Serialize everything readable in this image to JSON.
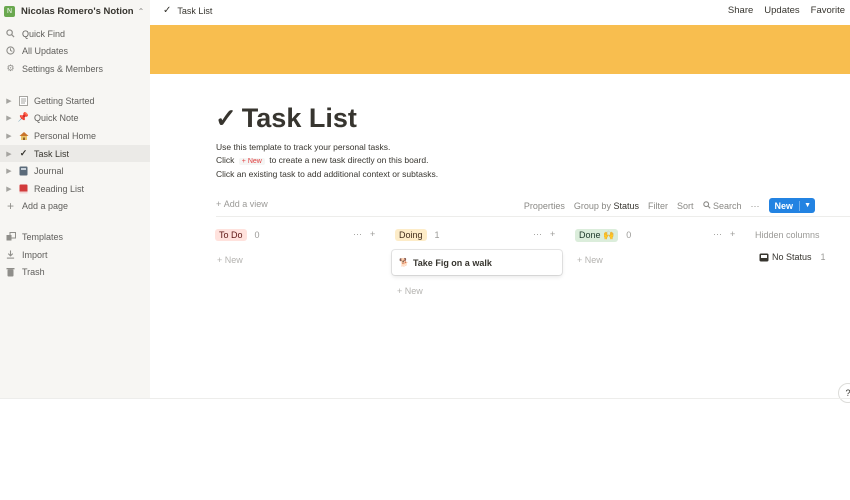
{
  "sidebar": {
    "workspace_badge": "N",
    "workspace_name": "Nicolas Romero's Notion",
    "top_items": [
      {
        "label": "Quick Find",
        "icon": "search-icon"
      },
      {
        "label": "All Updates",
        "icon": "clock-icon"
      },
      {
        "label": "Settings & Members",
        "icon": "gear-icon"
      }
    ],
    "pages": [
      {
        "label": "Getting Started",
        "icon": "page-icon"
      },
      {
        "label": "Quick Note",
        "icon": "pin-icon"
      },
      {
        "label": "Personal Home",
        "icon": "house-icon"
      },
      {
        "label": "Task List",
        "icon": "check-icon"
      },
      {
        "label": "Journal",
        "icon": "notebook-icon"
      },
      {
        "label": "Reading List",
        "icon": "book-icon"
      }
    ],
    "add_page": "Add a page",
    "bottom_items": [
      {
        "label": "Templates",
        "icon": "templates-icon"
      },
      {
        "label": "Import",
        "icon": "import-icon"
      },
      {
        "label": "Trash",
        "icon": "trash-icon"
      }
    ]
  },
  "topbar": {
    "breadcrumb": "Task List",
    "share": "Share",
    "updates": "Updates",
    "favorite": "Favorite"
  },
  "cover_color": "#f8be4f",
  "page": {
    "title": "Task List",
    "desc_line1": "Use this template to track your personal tasks.",
    "desc_line2_pre": "Click",
    "desc_line2_chip": "+ New",
    "desc_line2_post": "to create a new task directly on this board.",
    "desc_line3": "Click an existing task to add additional context or subtasks."
  },
  "view_bar": {
    "add_view": "Add a view",
    "properties": "Properties",
    "group_by": "Group by",
    "group_by_value": "Status",
    "filter": "Filter",
    "sort": "Sort",
    "search": "Search",
    "more": "···",
    "new": "New"
  },
  "board": {
    "columns": [
      {
        "label": "To Do",
        "count": "0"
      },
      {
        "label": "Doing",
        "count": "1"
      },
      {
        "label": "Done 🙌",
        "count": "0"
      }
    ],
    "new_label": "New",
    "card_title": "Take Fig on a walk",
    "hidden_columns": "Hidden columns",
    "no_status": "No Status",
    "no_status_count": "1"
  }
}
